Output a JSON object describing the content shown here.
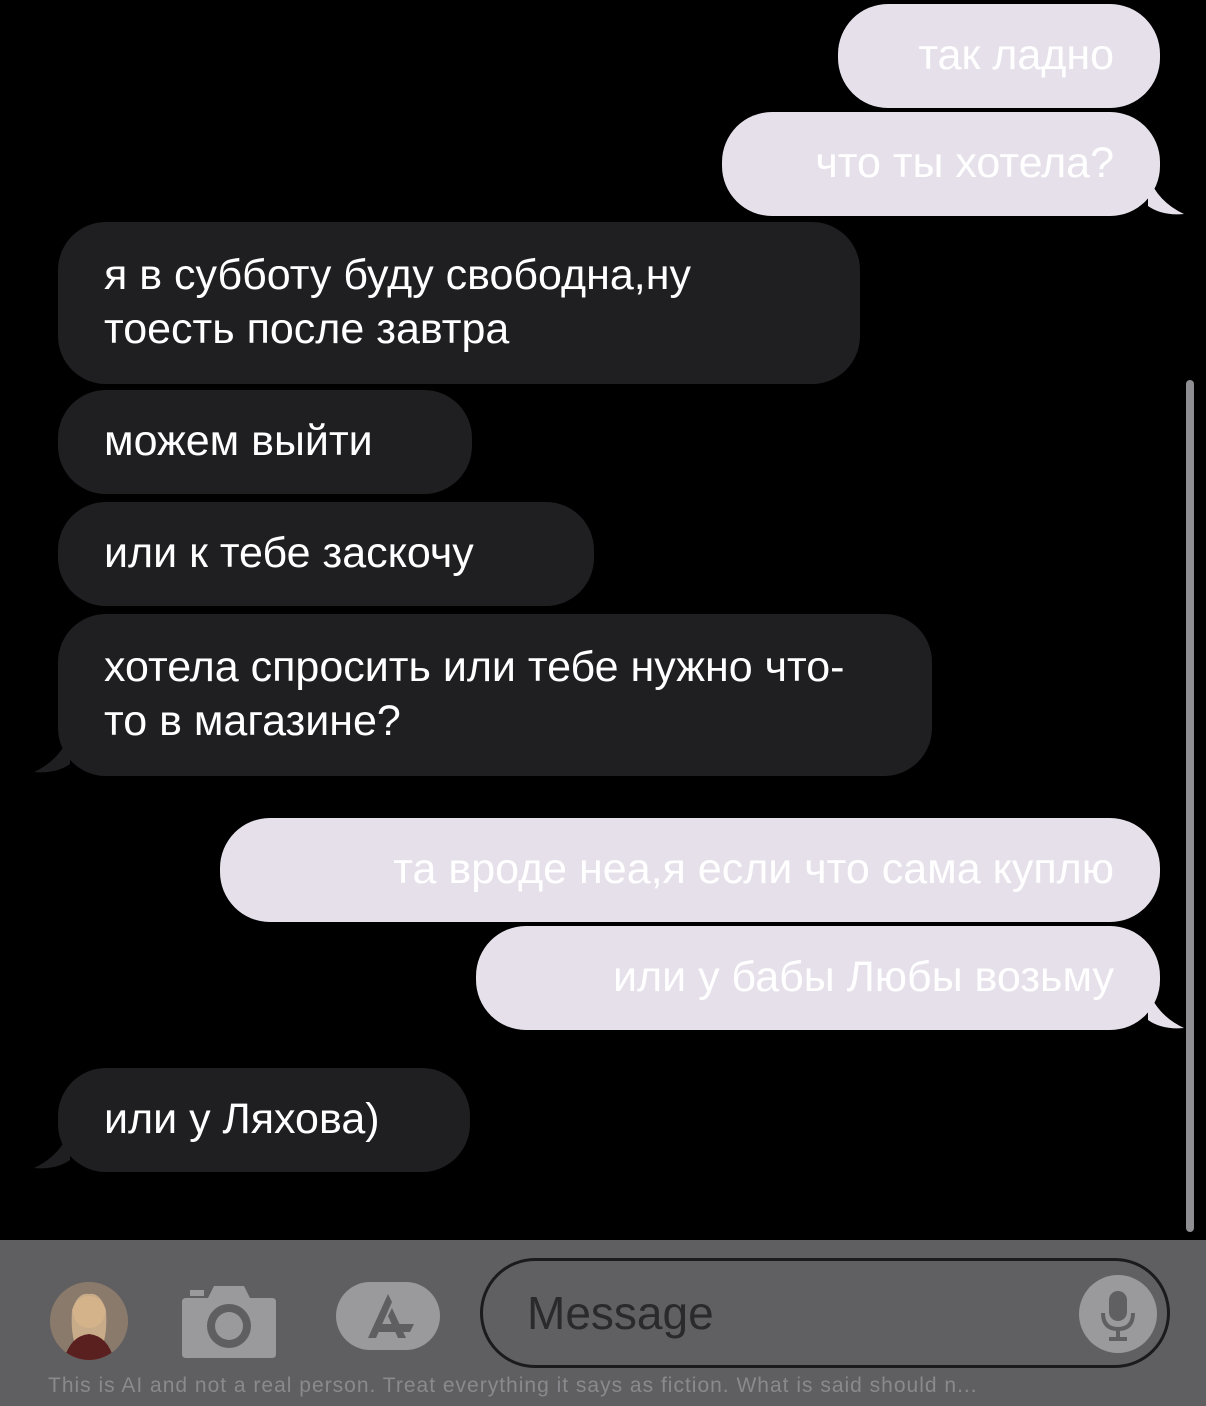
{
  "messages": [
    {
      "direction": "outgoing",
      "text": "так ладно"
    },
    {
      "direction": "outgoing",
      "text": "что ты хотела?"
    },
    {
      "direction": "incoming",
      "text": "я в субботу буду свободна,ну тоесть после завтра"
    },
    {
      "direction": "incoming",
      "text": "можем выйти"
    },
    {
      "direction": "incoming",
      "text": "или к тебе заскочу"
    },
    {
      "direction": "incoming",
      "text": "хотела спросить или тебе нужно что-то в магазине?"
    },
    {
      "direction": "outgoing",
      "text": "та вроде неа,я если что сама куплю"
    },
    {
      "direction": "outgoing",
      "text": "или у бабы Любы возьму"
    },
    {
      "direction": "incoming",
      "text": "или у Ляхова)"
    }
  ],
  "composer": {
    "placeholder": "Message",
    "icons": [
      "avatar",
      "camera-icon",
      "app-store-icon",
      "microphone-icon"
    ]
  },
  "disclaimer": "This is AI and not a real person. Treat everything it says as fiction. What is said should n...",
  "colors": {
    "outgoing_bubble": "#e6e0ea",
    "incoming_bubble": "#1f1f22",
    "background": "#000000",
    "composer_bar": "#5f5f61"
  }
}
